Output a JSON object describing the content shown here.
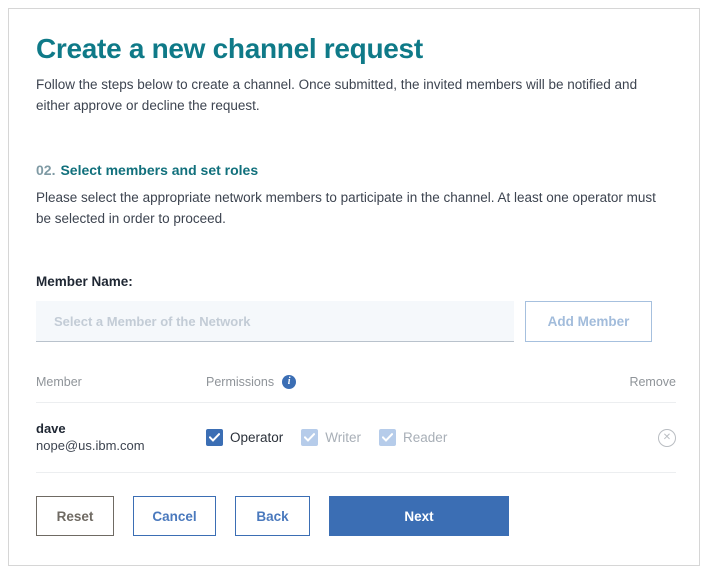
{
  "header": {
    "title": "Create a new channel request",
    "subtitle": "Follow the steps below to create a channel. Once submitted, the invited members will be notified and either approve or decline the request."
  },
  "step": {
    "number": "02.",
    "title": "Select members and set roles",
    "description": "Please select the appropriate network members to participate in the channel. At least one operator must be selected in order to proceed."
  },
  "member_form": {
    "label": "Member Name:",
    "placeholder": "Select a Member of the Network",
    "value": "",
    "add_button": "Add Member"
  },
  "table": {
    "headers": {
      "member": "Member",
      "permissions": "Permissions",
      "remove": "Remove"
    },
    "info_icon": "info-icon",
    "info_glyph": "i",
    "rows": [
      {
        "name": "dave",
        "email": "nope@us.ibm.com",
        "permissions": [
          {
            "label": "Operator",
            "checked": true,
            "enabled": true
          },
          {
            "label": "Writer",
            "checked": true,
            "enabled": false
          },
          {
            "label": "Reader",
            "checked": true,
            "enabled": false
          }
        ],
        "remove_icon": "remove-circle-x-icon",
        "remove_glyph": "✕"
      }
    ]
  },
  "footer": {
    "reset": "Reset",
    "cancel": "Cancel",
    "back": "Back",
    "next": "Next"
  },
  "colors": {
    "teal": "#0f7a88",
    "step_number": "#7f9aa4",
    "primary_blue": "#3b6eb4",
    "disabled_blue": "#b6ccea",
    "reset_gray": "#6f6a63",
    "frame_border": "#d6d6d6"
  }
}
